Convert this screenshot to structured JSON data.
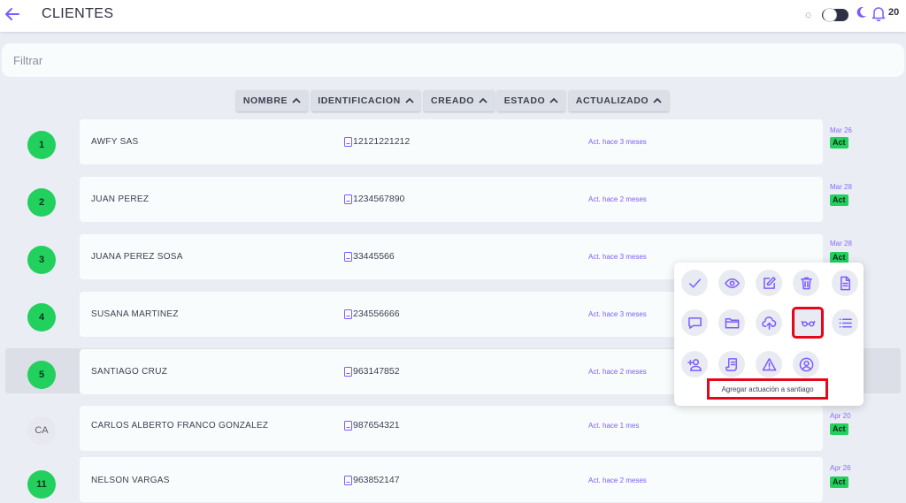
{
  "header": {
    "title": "CLIENTES",
    "notification_count": "20"
  },
  "filter": {
    "placeholder": "Filtrar",
    "value": ""
  },
  "sort_buttons": [
    "NOMBRE",
    "IDENTIFICACION",
    "CREADO",
    "ESTADO",
    "ACTUALIZADO"
  ],
  "clients": [
    {
      "avatar": "1",
      "name": "AWFY SAS",
      "identification": "12121221212",
      "updated": "Act. hace 3 meses",
      "date": "Mar 26",
      "status": "Act"
    },
    {
      "avatar": "2",
      "name": "JUAN PEREZ",
      "identification": "1234567890",
      "updated": "Act. hace 2 meses",
      "date": "Mar 28",
      "status": "Act"
    },
    {
      "avatar": "3",
      "name": "JUANA PEREZ SOSA",
      "identification": "33445566",
      "updated": "Act. hace 3 meses",
      "date": "Mar 28",
      "status": "Act"
    },
    {
      "avatar": "4",
      "name": "SUSANA MARTINEZ",
      "identification": "234556666",
      "updated": "Act. hace 3 meses",
      "date": "",
      "status": ""
    },
    {
      "avatar": "5",
      "name": "SANTIAGO CRUZ",
      "identification": "963147852",
      "updated": "Act. hace 2 meses",
      "date": "",
      "status": ""
    },
    {
      "avatar": "CA",
      "name": "CARLOS ALBERTO FRANCO GONZALEZ",
      "identification": "987654321",
      "updated": "Act. hace 1 mes",
      "date": "Apr 20",
      "status": "Act"
    },
    {
      "avatar": "11",
      "name": "NELSON VARGAS",
      "identification": "963852147",
      "updated": "Act. hace 2 meses",
      "date": "Apr 26",
      "status": "Act"
    }
  ],
  "actions_popup": {
    "icons": [
      "check-icon",
      "eye-icon",
      "edit-icon",
      "trash-icon",
      "document-icon",
      "comment-icon",
      "folder-icon",
      "cloud-upload-icon",
      "glasses-icon",
      "list-icon",
      "add-user-icon",
      "invoice-icon",
      "warning-icon",
      "user-circle-icon"
    ],
    "tooltip": "Agregar actuación a santiago"
  },
  "colors": {
    "accent": "#7c5cff",
    "active_green": "#22d05e",
    "highlight_red": "#e5081d"
  }
}
